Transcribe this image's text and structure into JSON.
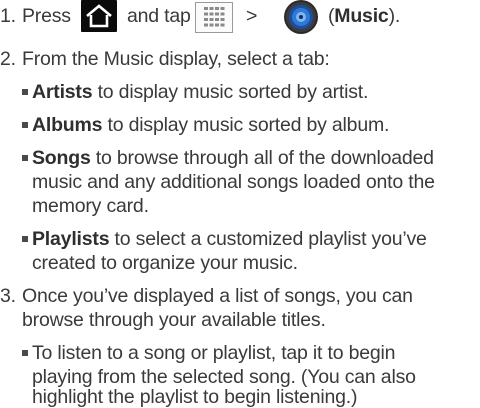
{
  "step1": {
    "number": "1.",
    "press": "Press",
    "and_tap": "and tap",
    "gt": ">",
    "music_open": "(",
    "music_label": "Music",
    "music_close": ")."
  },
  "step2": {
    "number": "2.",
    "intro": "From the Music display, select a tab:",
    "bullets": [
      {
        "bold": "Artists",
        "text_lines": [
          " to display music sorted by artist."
        ]
      },
      {
        "bold": "Albums",
        "text_lines": [
          " to display music sorted by album."
        ]
      },
      {
        "bold": "Songs",
        "text_lines": [
          " to browse through all of the downloaded",
          "music and any additional songs loaded onto the",
          "memory card."
        ]
      },
      {
        "bold": "Playlists",
        "text_lines": [
          " to select a customized playlist you’ve",
          "created to organize your music."
        ]
      }
    ]
  },
  "step3": {
    "number": "3.",
    "intro_lines": [
      "Once you’ve displayed a list of songs, you can",
      "browse through your available titles."
    ],
    "bullets": [
      {
        "text_lines": [
          "To listen to a song or playlist, tap it to begin",
          "playing from the selected song. (You can also",
          "highlight the playlist to begin listening.)"
        ]
      }
    ]
  },
  "icons": {
    "home": "home-icon",
    "apps": "apps-grid-icon",
    "music": "music-app-icon"
  }
}
